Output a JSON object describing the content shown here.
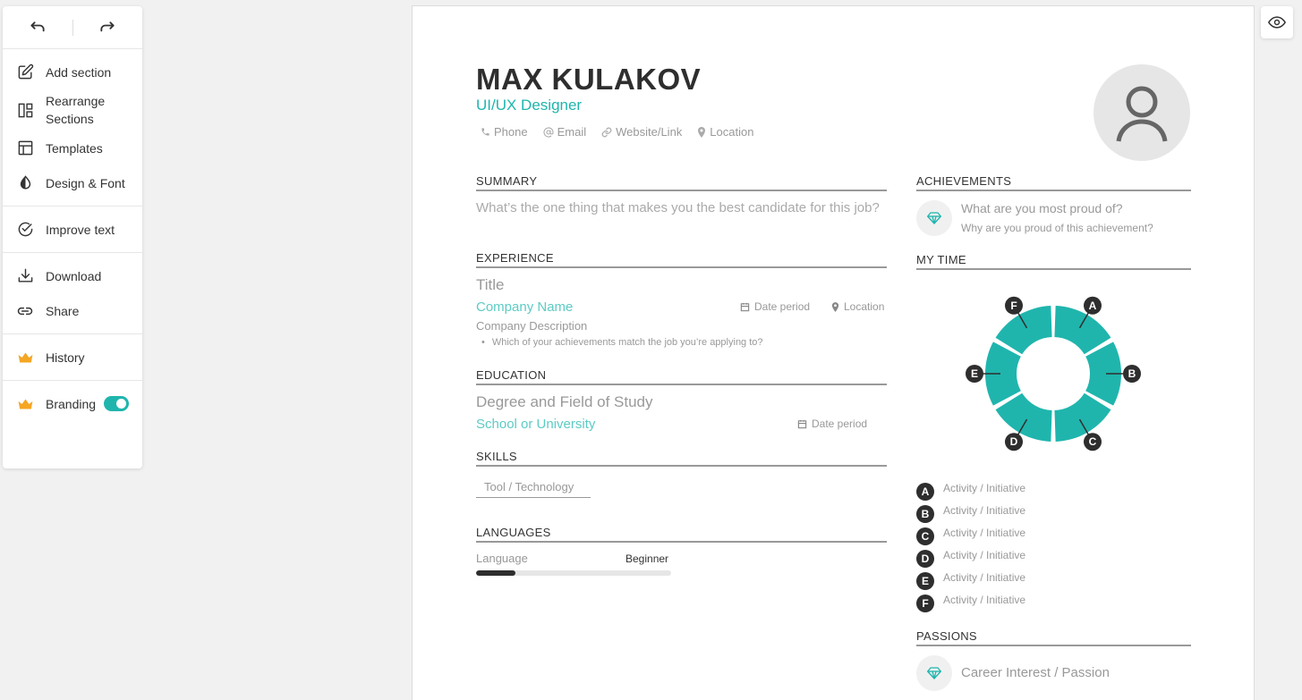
{
  "sidebar": {
    "groups": [
      [
        {
          "label": "Add section",
          "icon": "edit-icon"
        },
        {
          "label": "Rearrange Sections",
          "icon": "layout-sections-icon"
        },
        {
          "label": "Templates",
          "icon": "template-icon"
        },
        {
          "label": "Design & Font",
          "icon": "contrast-icon"
        }
      ],
      [
        {
          "label": "Improve text",
          "icon": "check-circle-icon"
        }
      ],
      [
        {
          "label": "Download",
          "icon": "download-icon"
        },
        {
          "label": "Share",
          "icon": "link-icon"
        }
      ],
      [
        {
          "label": "History",
          "icon": "crown-icon"
        }
      ],
      [
        {
          "label": "Branding",
          "icon": "crown-icon",
          "toggle": true
        }
      ]
    ]
  },
  "resume": {
    "name": "MAX KULAKOV",
    "role": "UI/UX Designer",
    "contacts": {
      "phone": "Phone",
      "email": "Email",
      "website": "Website/Link",
      "location": "Location"
    },
    "summary": {
      "title": "SUMMARY",
      "text": "What’s the one thing that makes you the best candidate for this job?"
    },
    "experience": {
      "title": "EXPERIENCE",
      "job_title": "Title",
      "company": "Company Name",
      "date": "Date period",
      "location": "Location",
      "description": "Company Description",
      "bullet": "Which of your achievements match the job you’re applying to?"
    },
    "education": {
      "title": "EDUCATION",
      "degree": "Degree and Field of Study",
      "school": "School or University",
      "date": "Date period"
    },
    "skills": {
      "title": "SKILLS",
      "item": "Tool / Technology"
    },
    "languages": {
      "title": "LANGUAGES",
      "name": "Language",
      "level": "Beginner",
      "level_fraction": 0.2
    },
    "achievements": {
      "title": "ACHIEVEMENTS",
      "question": "What are you most proud of?",
      "description": "Why are you proud of this achievement?"
    },
    "my_time": {
      "title": "MY TIME",
      "color": "#1fb5ad",
      "segments": [
        "A",
        "B",
        "C",
        "D",
        "E",
        "F"
      ],
      "legend": [
        {
          "letter": "A",
          "text": "Activity / Initiative"
        },
        {
          "letter": "B",
          "text": "Activity / Initiative"
        },
        {
          "letter": "C",
          "text": "Activity / Initiative"
        },
        {
          "letter": "D",
          "text": "Activity / Initiative"
        },
        {
          "letter": "E",
          "text": "Activity / Initiative"
        },
        {
          "letter": "F",
          "text": "Activity / Initiative"
        }
      ]
    },
    "passions": {
      "title": "PASSIONS",
      "item": "Career Interest / Passion"
    }
  },
  "colors": {
    "accent": "#1fb5ad",
    "crown": "#f5a623"
  }
}
